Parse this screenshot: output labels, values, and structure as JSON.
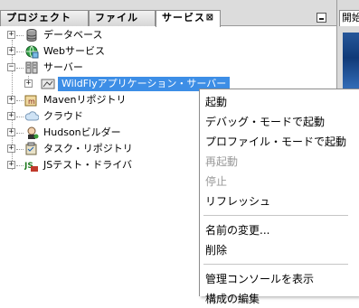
{
  "tabs": [
    {
      "label": "プロジェクト"
    },
    {
      "label": "ファイル"
    },
    {
      "label": "サービス",
      "close_glyph": "⊠"
    }
  ],
  "right_pane": {
    "tab_label": "開始"
  },
  "tree": {
    "items": [
      {
        "label": "データベース",
        "icon": "database-icon",
        "expander": "+"
      },
      {
        "label": "Webサービス",
        "icon": "web-services-icon",
        "expander": "+"
      },
      {
        "label": "サーバー",
        "icon": "servers-icon",
        "expander": "−"
      },
      {
        "label": "WildFlyアプリケーション・サーバー",
        "icon": "wildfly-server-icon",
        "expander": "+",
        "selected": true
      },
      {
        "label": "Mavenリポジトリ",
        "icon": "maven-repository-icon",
        "expander": "+"
      },
      {
        "label": "クラウド",
        "icon": "cloud-icon",
        "expander": "+"
      },
      {
        "label": "Hudsonビルダー",
        "icon": "hudson-builder-icon",
        "expander": "+"
      },
      {
        "label": "タスク・リポジトリ",
        "icon": "task-repository-icon",
        "expander": "+"
      },
      {
        "label": "JSテスト・ドライバ",
        "icon": "js-test-driver-icon",
        "expander": "+"
      }
    ]
  },
  "context_menu": {
    "items": [
      {
        "label": "起動",
        "enabled": true
      },
      {
        "label": "デバッグ・モードで起動",
        "enabled": true
      },
      {
        "label": "プロファイル・モードで起動",
        "enabled": true
      },
      {
        "label": "再起動",
        "enabled": false
      },
      {
        "label": "停止",
        "enabled": false
      },
      {
        "label": "リフレッシュ",
        "enabled": true
      },
      {
        "label": "名前の変更...",
        "enabled": true
      },
      {
        "label": "削除",
        "enabled": true
      },
      {
        "label": "管理コンソールを表示",
        "enabled": true
      },
      {
        "label": "構成の編集",
        "enabled": true
      }
    ]
  }
}
